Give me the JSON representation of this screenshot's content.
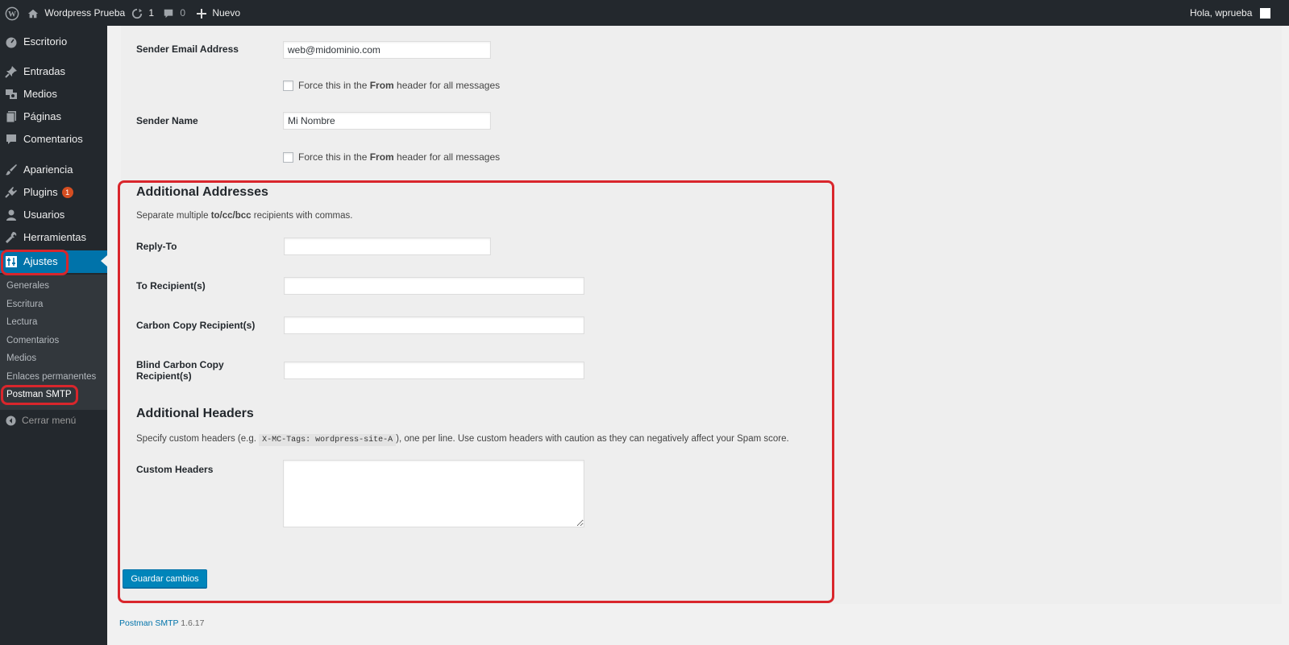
{
  "adminbar": {
    "site_name": "Wordpress Prueba",
    "updates_count": "1",
    "comments_count": "0",
    "new_label": "Nuevo",
    "greeting": "Hola, wprueba"
  },
  "menu": {
    "items": [
      {
        "label": "Escritorio",
        "icon": "dashboard-icon"
      },
      {
        "label": "Entradas",
        "icon": "pin-icon"
      },
      {
        "label": "Medios",
        "icon": "media-icon"
      },
      {
        "label": "Páginas",
        "icon": "pages-icon"
      },
      {
        "label": "Comentarios",
        "icon": "comments-icon"
      },
      {
        "label": "Apariencia",
        "icon": "brush-icon"
      },
      {
        "label": "Plugins",
        "icon": "plugin-icon",
        "badge": "1"
      },
      {
        "label": "Usuarios",
        "icon": "user-icon"
      },
      {
        "label": "Herramientas",
        "icon": "wrench-icon"
      },
      {
        "label": "Ajustes",
        "icon": "settings-icon",
        "current": true
      }
    ],
    "submenu": [
      "Generales",
      "Escritura",
      "Lectura",
      "Comentarios",
      "Medios",
      "Enlaces permanentes",
      "Postman SMTP"
    ],
    "collapse_label": "Cerrar menú"
  },
  "form": {
    "sender_email_label": "Sender Email Address",
    "sender_email_value": "web@midominio.com",
    "force_from_prefix": "Force this in the ",
    "force_from_bold": "From",
    "force_from_suffix": " header for all messages",
    "sender_name_label": "Sender Name",
    "sender_name_value": "Mi Nombre",
    "additional_addresses_title": "Additional Addresses",
    "addresses_desc_prefix": "Separate multiple ",
    "addresses_desc_bold": "to/cc/bcc",
    "addresses_desc_suffix": " recipients with commas.",
    "reply_to_label": "Reply-To",
    "to_label": "To Recipient(s)",
    "cc_label": "Carbon Copy Recipient(s)",
    "bcc_label_line1": "Blind Carbon Copy",
    "bcc_label_line2": "Recipient(s)",
    "additional_headers_title": "Additional Headers",
    "headers_desc_prefix": "Specify custom headers (e.g. ",
    "headers_desc_code": "X-MC-Tags: wordpress-site-A",
    "headers_desc_suffix": "), one per line. Use custom headers with caution as they can negatively affect your Spam score.",
    "custom_headers_label": "Custom Headers",
    "save_button": "Guardar cambios"
  },
  "footer": {
    "plugin_name": "Postman SMTP",
    "version": "1.6.17"
  },
  "colors": {
    "admin_bar": "#23282d",
    "menu_current": "#0073aa",
    "highlight": "#d9262c",
    "button": "#0085ba"
  }
}
